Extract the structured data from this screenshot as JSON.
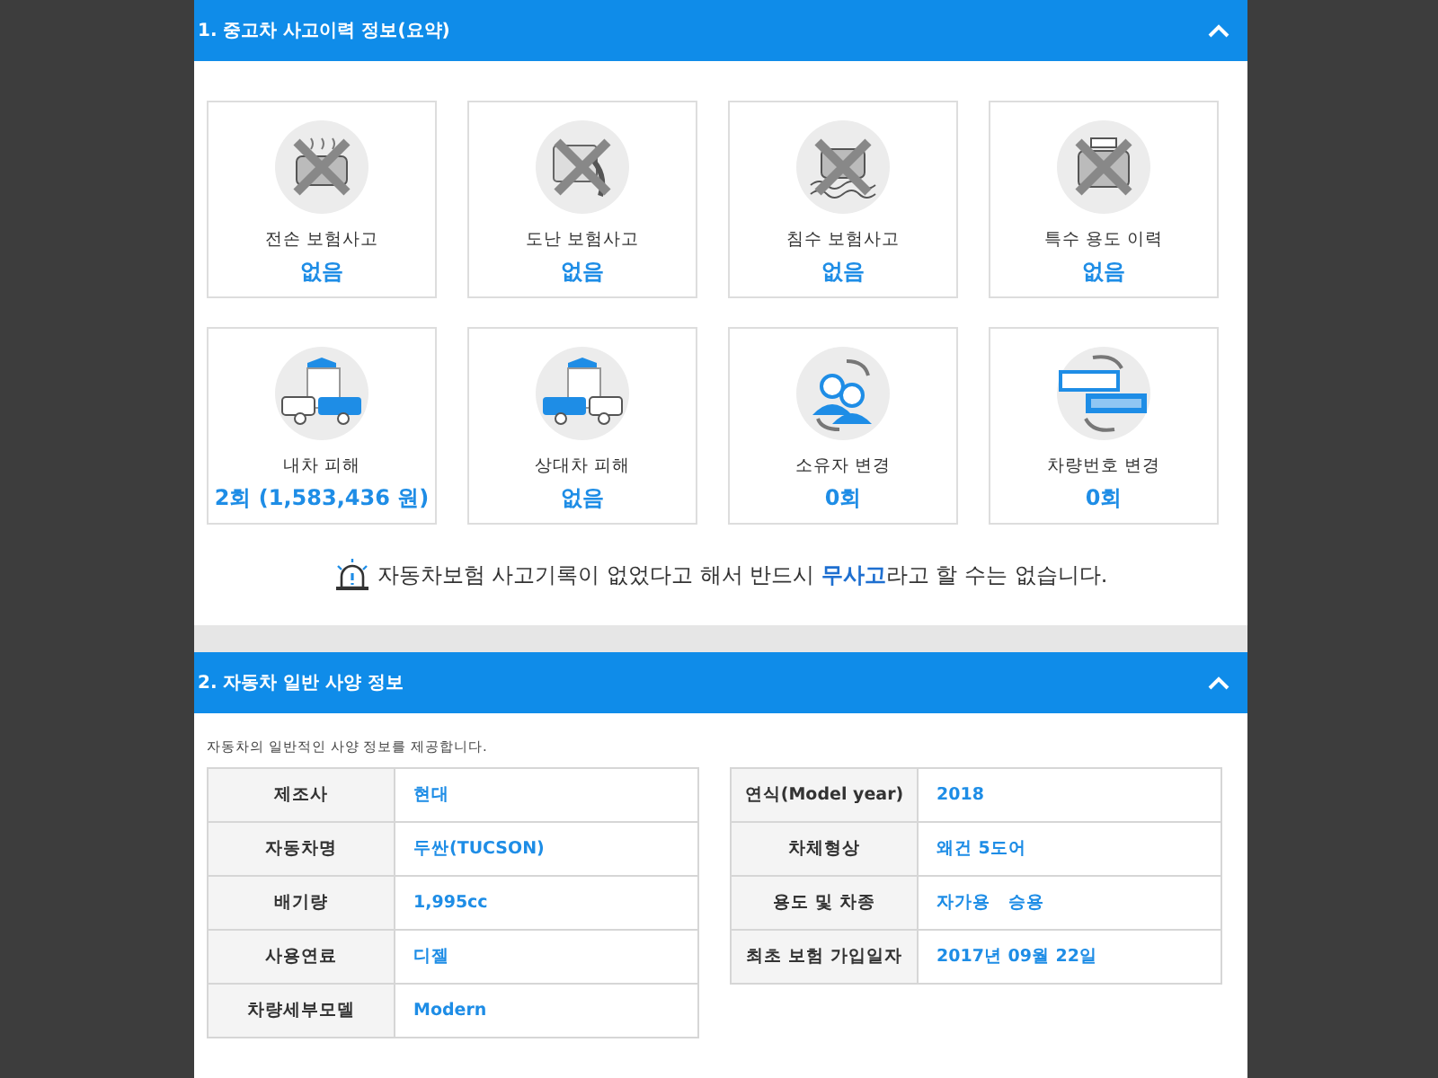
{
  "accident_section": {
    "title": "1. 중고차 사고이력 정보(요약)",
    "expanded": true,
    "cards": [
      {
        "label": "전손 보험사고",
        "value": "없음",
        "crossed": true
      },
      {
        "label": "도난 보험사고",
        "value": "없음",
        "crossed": true
      },
      {
        "label": "침수 보험사고",
        "value": "없음",
        "crossed": true
      },
      {
        "label": "특수 용도 이력",
        "value": "없음",
        "crossed": true
      },
      {
        "label": "내차 피해",
        "value": "2회 (1,583,436 원)",
        "crossed": false
      },
      {
        "label": "상대차 피해",
        "value": "없음",
        "crossed": false
      },
      {
        "label": "소유자 변경",
        "value": "0회",
        "crossed": false
      },
      {
        "label": "차량번호 변경",
        "value": "0회",
        "crossed": false
      }
    ],
    "notice": "자동차보험 사고기록이 없었다고 해서 반드시 **무사고**라고 할 수는 없습니다."
  },
  "spec_section": {
    "title": "2. 자동차 일반 사양 정보",
    "expanded": true,
    "description": "자동차의 일반적인 사양 정보를 제공합니다.",
    "left_table": [
      {
        "label": "제조사",
        "value": "현대"
      },
      {
        "label": "자동차명",
        "value": "두싼(TUCSON)"
      },
      {
        "label": "배기량",
        "value": "1,995cc"
      },
      {
        "label": "사용연료",
        "value": "디젤"
      },
      {
        "label": "차량세부모델",
        "value": "Modern"
      }
    ],
    "right_table": [
      {
        "label": "연식(Model year)",
        "value": "2018"
      },
      {
        "label": "차체형상",
        "value": "왜건 5도어"
      },
      {
        "label": "용도 및 차종",
        "value": "자가용   승용"
      },
      {
        "label": "최초 보험 가입일자",
        "value": "2017년 09월 22일"
      }
    ]
  }
}
